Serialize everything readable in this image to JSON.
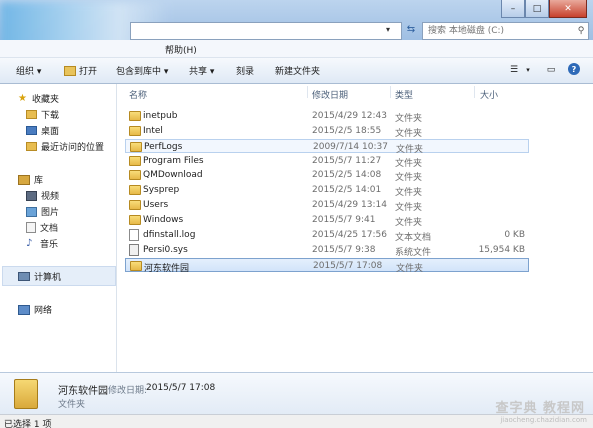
{
  "window": {
    "menu_help": "帮助(H)",
    "search_placeholder": "搜索 本地磁盘 (C:)"
  },
  "toolbar": {
    "organize": "组织 ▾",
    "open": "打开",
    "include_library": "包含到库中 ▾",
    "share": "共享 ▾",
    "burn": "刻录",
    "new_folder": "新建文件夹"
  },
  "nav": {
    "favorites": "收藏夹",
    "downloads": "下载",
    "desktop": "桌面",
    "recent": "最近访问的位置",
    "libraries": "库",
    "videos": "视频",
    "pictures": "图片",
    "documents": "文档",
    "music": "音乐",
    "computer": "计算机",
    "network": "网络"
  },
  "columns": {
    "name": "名称",
    "date": "修改日期",
    "type": "类型",
    "size": "大小"
  },
  "files": [
    {
      "name": "inetpub",
      "date": "2015/4/29 12:43",
      "type": "文件夹",
      "size": "",
      "kind": "folder"
    },
    {
      "name": "Intel",
      "date": "2015/2/5 18:55",
      "type": "文件夹",
      "size": "",
      "kind": "folder"
    },
    {
      "name": "PerfLogs",
      "date": "2009/7/14 10:37",
      "type": "文件夹",
      "size": "",
      "kind": "folder"
    },
    {
      "name": "Program Files",
      "date": "2015/5/7 11:27",
      "type": "文件夹",
      "size": "",
      "kind": "folder"
    },
    {
      "name": "QMDownload",
      "date": "2015/2/5 14:08",
      "type": "文件夹",
      "size": "",
      "kind": "folder"
    },
    {
      "name": "Sysprep",
      "date": "2015/2/5 14:01",
      "type": "文件夹",
      "size": "",
      "kind": "folder"
    },
    {
      "name": "Users",
      "date": "2015/4/29 13:14",
      "type": "文件夹",
      "size": "",
      "kind": "folder"
    },
    {
      "name": "Windows",
      "date": "2015/5/7 9:41",
      "type": "文件夹",
      "size": "",
      "kind": "folder"
    },
    {
      "name": "dfinstall.log",
      "date": "2015/4/25 17:56",
      "type": "文本文档",
      "size": "0 KB",
      "kind": "file"
    },
    {
      "name": "Persi0.sys",
      "date": "2015/5/7 9:38",
      "type": "系统文件",
      "size": "15,954 KB",
      "kind": "sys"
    },
    {
      "name": "河东软件园",
      "date": "2015/5/7 17:08",
      "type": "文件夹",
      "size": "",
      "kind": "folder"
    }
  ],
  "details": {
    "name": "河东软件园",
    "modified_label": "修改日期:",
    "modified_value": "2015/5/7 17:08",
    "type": "文件夹"
  },
  "status": {
    "text": "已选择 1 项"
  },
  "watermark": {
    "main": "查字典 教程网",
    "sub": "jiaocheng.chazidian.com"
  },
  "colors": {
    "selection_border": "#7da2ce",
    "selection_fill": "#d2e4fa",
    "toolbar_bg": "#dfe9f5"
  }
}
